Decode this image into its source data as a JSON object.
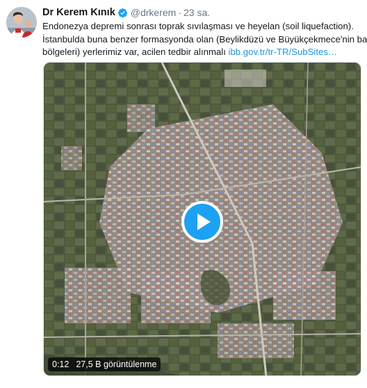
{
  "tweet": {
    "name": "Dr Kerem Kınık",
    "handle": "@drkerem",
    "separator": "·",
    "time": "23 sa.",
    "text_lines": [
      "Endonezya depremi sonrası toprak sıvılaşması ve heyelan (soil liquefaction).",
      "İstanbulda buna benzer formasyonda olan (Beylikdüzü ve Büyükçekmece'nin bazı",
      "bölgeleri) yerlerimiz var, acilen tedbir alınmalı"
    ],
    "link_text": "ibb.gov.tr/tr-TR/SubSites…"
  },
  "video": {
    "duration": "0:12",
    "views": "27,5 B görüntülenme"
  },
  "colors": {
    "link": "#1b95e0",
    "play_button": "#1da1f2",
    "secondary_text": "#657786"
  }
}
